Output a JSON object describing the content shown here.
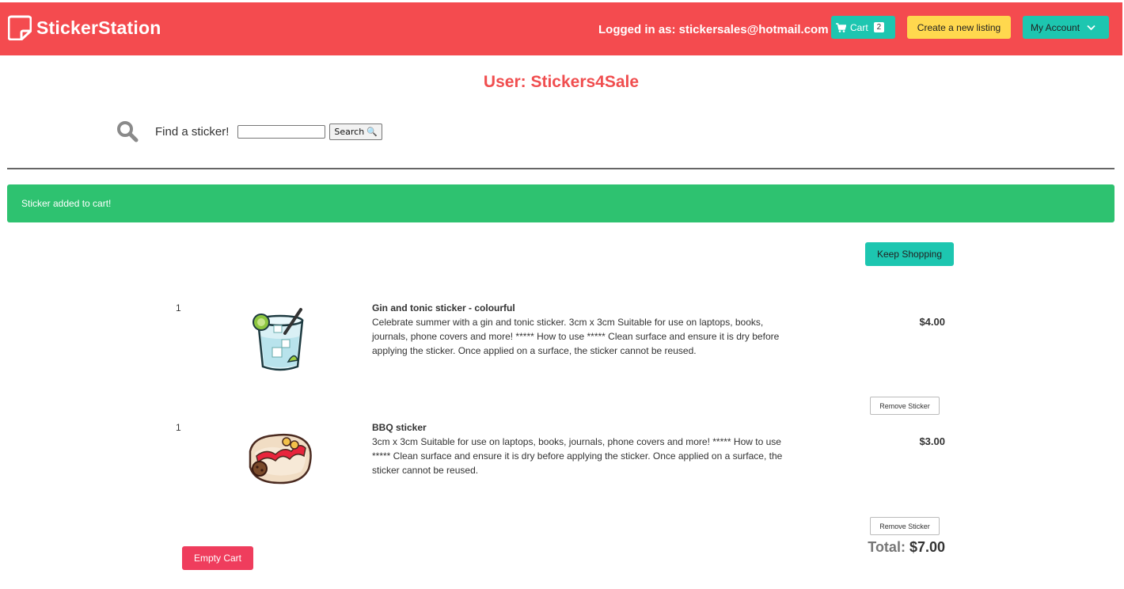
{
  "nav": {
    "brand": "StickerStation",
    "logged_in": "Logged in as: stickersales@hotmail.com",
    "cart_label": "Cart",
    "cart_count": "2",
    "create_label": "Create a new listing",
    "account_label": "My Account"
  },
  "user_title": "User: Stickers4Sale",
  "search": {
    "label": "Find a sticker!",
    "value": "",
    "button_label": "Search"
  },
  "alert": "Sticker added to cart!",
  "keep_shopping_label": "Keep Shopping",
  "items": [
    {
      "qty": "1",
      "name": "Gin and tonic sticker - colourful",
      "description": "Celebrate summer with a gin and tonic sticker. 3cm x 3cm Suitable for use on laptops, books, journals, phone covers and more! ***** How to use ***** Clean surface and ensure it is dry before applying the sticker. Once applied on a surface, the sticker cannot be reused.",
      "price": "$4.00",
      "remove_label": "Remove Sticker",
      "image_icon": "gin-tonic-icon"
    },
    {
      "qty": "1",
      "name": "BBQ sticker",
      "description": " 3cm x 3cm Suitable for use on laptops, books, journals, phone covers and more! ***** How to use ***** Clean surface and ensure it is dry before applying the sticker. Once applied on a surface, the sticker cannot be reused.",
      "price": "$3.00",
      "remove_label": "Remove Sticker",
      "image_icon": "bbq-toast-icon"
    }
  ],
  "empty_cart_label": "Empty Cart",
  "total": {
    "label": "Total:",
    "amount": "$7.00"
  },
  "colors": {
    "navbar": "#f44b4f",
    "teal": "#1dc6b0",
    "yellow": "#ffd84e",
    "success": "#2ec270",
    "danger": "#ef3d5d",
    "title": "#f04e4f"
  }
}
